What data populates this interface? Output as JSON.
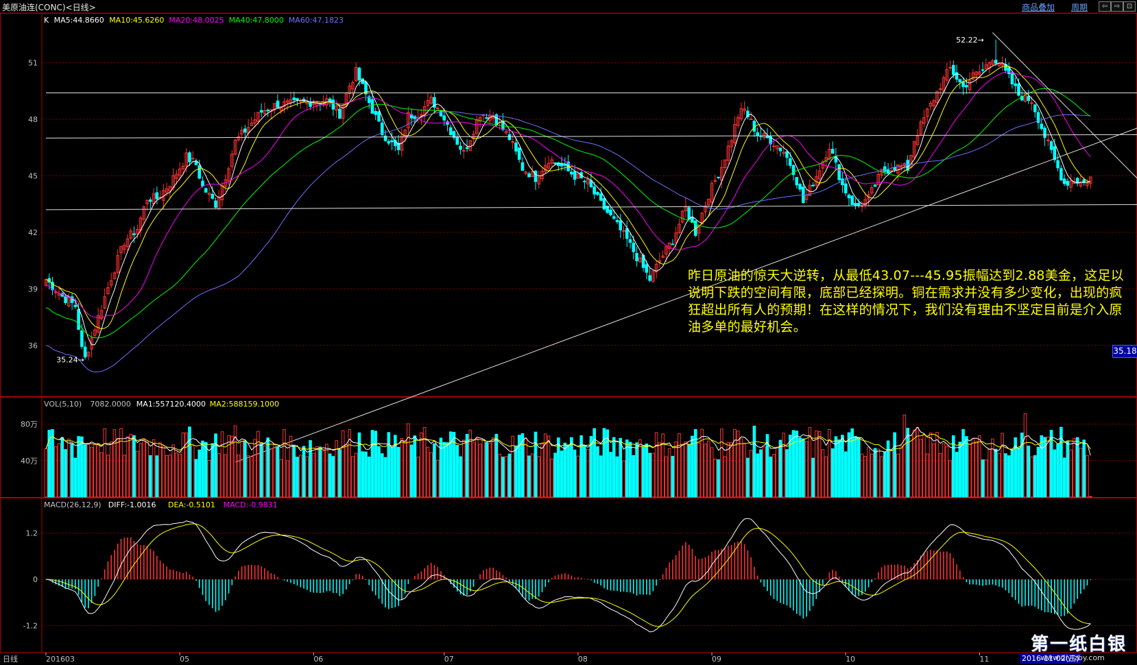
{
  "app": {
    "title": "美原油连(CONC)<日线>",
    "overlay_link": "商品叠加",
    "period_link": "周期",
    "window_buttons": [
      "⇦",
      "⇨",
      "⊡"
    ]
  },
  "colors": {
    "up": "#ff3232",
    "down": "#00ffff",
    "grid": "#8b0000",
    "frame": "#b00000",
    "ma5": "#ffffff",
    "ma10": "#ffff00",
    "ma20": "#ff00ff",
    "ma40": "#00ff00",
    "ma60": "#7070ff",
    "diff": "#ffffff",
    "dea": "#ffff00",
    "text_yellow": "#ffff00",
    "text_magenta": "#ff00ff"
  },
  "price_panel": {
    "legend": [
      {
        "label": "K",
        "color": "#ffffff"
      },
      {
        "label": "MA5:44.8660",
        "color": "#ffffff"
      },
      {
        "label": "MA10:45.6260",
        "color": "#ffff00"
      },
      {
        "label": "MA20:48.0025",
        "color": "#ff00ff"
      },
      {
        "label": "MA40:47.8000",
        "color": "#00ff00"
      },
      {
        "label": "MA60:47.1823",
        "color": "#7070ff"
      }
    ],
    "current_price": "35.18",
    "high_label": "52.22",
    "low_label": "35.24",
    "annotation": "昨日原油的惊天大逆转，从最低43.07---45.95振幅达到2.88美金，这足以说明下跌的空间有限，底部已经探明。铜在需求并没有多少变化，出现的疯狂超出所有人的预期！在这样的情况下，我们没有理由不坚定目前是介入原油多单的最好机会。"
  },
  "volume_panel": {
    "legend": [
      {
        "label": "VOL(5,10)",
        "color": "#c0c0c0"
      },
      {
        "label": "7082.0000",
        "color": "#c0c0c0"
      },
      {
        "label": "MA1:557120.4000",
        "color": "#ffffff"
      },
      {
        "label": "MA2:588159.1000",
        "color": "#ffff00"
      }
    ]
  },
  "macd_panel": {
    "legend": [
      {
        "label": "MACD(26,12,9)",
        "color": "#c0c0c0"
      },
      {
        "label": "DIFF:-1.0016",
        "color": "#ffffff"
      },
      {
        "label": "DEA:-0.5101",
        "color": "#ffff00"
      },
      {
        "label": "MACD:-0.9831",
        "color": "#ff00ff"
      }
    ]
  },
  "footer": {
    "period": "日线",
    "date_tag": "2016-11-02(三)"
  },
  "watermark": {
    "title": "第一纸白银",
    "url": "www.diyizby.com"
  },
  "chart_data": {
    "type": "candlestick",
    "price_axis": {
      "ticks": [
        36,
        39,
        42,
        45,
        48,
        51
      ],
      "ylim": [
        33.3,
        53.6
      ]
    },
    "volume_axis": {
      "ticks": [
        400000,
        800000
      ],
      "tick_labels": [
        "40万",
        "80万"
      ],
      "ylim": [
        0,
        1000000
      ]
    },
    "macd_axis": {
      "ticks": [
        -1.2,
        0,
        1.2
      ],
      "ylim": [
        -1.9,
        2.1
      ]
    },
    "x_labels": [
      {
        "label": "201603",
        "index": 0
      },
      {
        "label": "05",
        "index": 41
      },
      {
        "label": "06",
        "index": 82
      },
      {
        "label": "07",
        "index": 122
      },
      {
        "label": "08",
        "index": 163
      },
      {
        "label": "09",
        "index": 204
      },
      {
        "label": "10",
        "index": 245
      },
      {
        "label": "11",
        "index": 286
      }
    ],
    "price_keypoints": [
      [
        0,
        39.5
      ],
      [
        5,
        38.6
      ],
      [
        9,
        38.1
      ],
      [
        11,
        35.8
      ],
      [
        12,
        35.3
      ],
      [
        16,
        37.5
      ],
      [
        20,
        39.6
      ],
      [
        24,
        41.5
      ],
      [
        28,
        42.2
      ],
      [
        31,
        43.8
      ],
      [
        34,
        43.8
      ],
      [
        38,
        44.6
      ],
      [
        43,
        46.0
      ],
      [
        46,
        45.6
      ],
      [
        48,
        44.4
      ],
      [
        52,
        43.5
      ],
      [
        55,
        45.0
      ],
      [
        58,
        46.8
      ],
      [
        62,
        47.6
      ],
      [
        66,
        48.4
      ],
      [
        71,
        48.8
      ],
      [
        75,
        48.8
      ],
      [
        80,
        48.9
      ],
      [
        86,
        49.0
      ],
      [
        90,
        48.3
      ],
      [
        93,
        49.8
      ],
      [
        95,
        50.5
      ],
      [
        99,
        48.9
      ],
      [
        103,
        47.3
      ],
      [
        108,
        46.3
      ],
      [
        111,
        48.2
      ],
      [
        114,
        48.3
      ],
      [
        118,
        49.0
      ],
      [
        121,
        48.4
      ],
      [
        124,
        47.4
      ],
      [
        128,
        46.2
      ],
      [
        133,
        48.3
      ],
      [
        137,
        48.2
      ],
      [
        142,
        47.0
      ],
      [
        146,
        45.4
      ],
      [
        150,
        44.9
      ],
      [
        154,
        45.9
      ],
      [
        158,
        45.5
      ],
      [
        162,
        45.0
      ],
      [
        166,
        44.6
      ],
      [
        170,
        43.5
      ],
      [
        174,
        42.6
      ],
      [
        178,
        41.6
      ],
      [
        182,
        40.4
      ],
      [
        185,
        39.5
      ],
      [
        188,
        40.5
      ],
      [
        192,
        41.6
      ],
      [
        196,
        43.3
      ],
      [
        199,
        42.0
      ],
      [
        203,
        44.0
      ],
      [
        207,
        45.5
      ],
      [
        210,
        47.0
      ],
      [
        212,
        48.2
      ],
      [
        214,
        48.5
      ],
      [
        218,
        47.2
      ],
      [
        222,
        46.9
      ],
      [
        226,
        46.3
      ],
      [
        229,
        45.3
      ],
      [
        232,
        43.6
      ],
      [
        236,
        45.0
      ],
      [
        240,
        46.6
      ],
      [
        244,
        44.5
      ],
      [
        248,
        43.3
      ],
      [
        252,
        43.8
      ],
      [
        256,
        45.2
      ],
      [
        260,
        45.5
      ],
      [
        264,
        45.4
      ],
      [
        266,
        46.9
      ],
      [
        270,
        48.4
      ],
      [
        274,
        49.8
      ],
      [
        277,
        50.7
      ],
      [
        281,
        49.7
      ],
      [
        284,
        50.3
      ],
      [
        287,
        50.6
      ],
      [
        290,
        51.3
      ],
      [
        292,
        51.0
      ],
      [
        295,
        50.2
      ],
      [
        298,
        49.3
      ],
      [
        302,
        49.0
      ],
      [
        306,
        47.1
      ],
      [
        309,
        45.8
      ],
      [
        312,
        44.6
      ],
      [
        315,
        44.8
      ],
      [
        318,
        44.6
      ],
      [
        320,
        44.9
      ]
    ],
    "series": [
      {
        "name": "MA5",
        "color": "#ffffff"
      },
      {
        "name": "MA10",
        "color": "#ffff00"
      },
      {
        "name": "MA20",
        "color": "#ff00ff"
      },
      {
        "name": "MA40",
        "color": "#00ff00"
      },
      {
        "name": "MA60",
        "color": "#7070ff"
      },
      {
        "name": "DIFF",
        "color": "#ffffff"
      },
      {
        "name": "DEA",
        "color": "#ffff00"
      }
    ],
    "high": {
      "value": 52.22,
      "index": 291
    },
    "low": {
      "value": 35.24,
      "index": 12
    },
    "trendlines": [
      {
        "from": [
          58,
          29.8
        ],
        "to": [
          365,
          49.5
        ]
      },
      {
        "from": [
          290,
          52.6
        ],
        "to": [
          345,
          43.0
        ]
      },
      {
        "from": [
          0,
          43.2
        ],
        "to": [
          365,
          43.5
        ]
      },
      {
        "from": [
          0,
          47.0
        ],
        "to": [
          365,
          47.2
        ]
      },
      {
        "from": [
          0,
          49.4
        ],
        "to": [
          365,
          49.4
        ]
      }
    ]
  }
}
